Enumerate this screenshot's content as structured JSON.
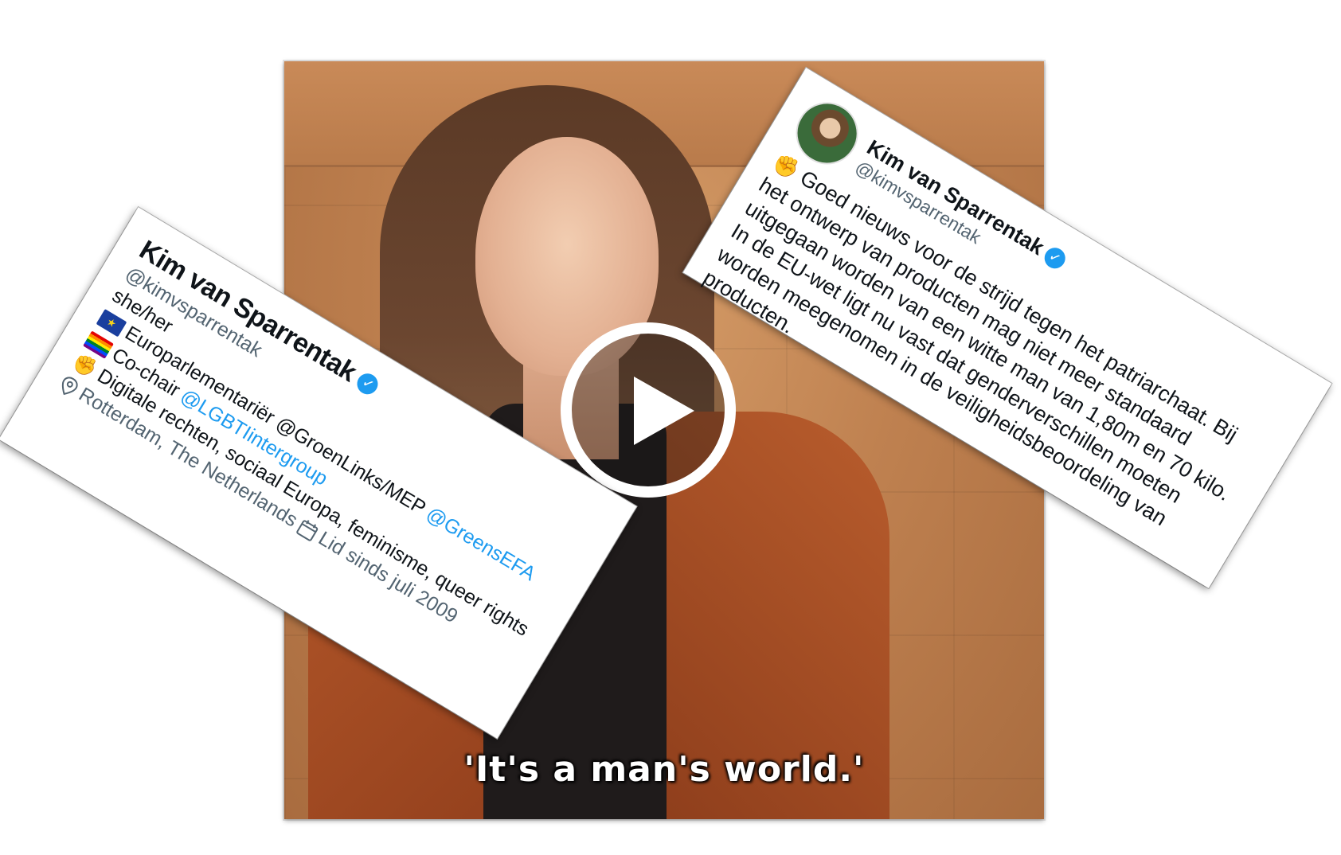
{
  "video": {
    "subtitle": "'It's a man's world.'"
  },
  "profile": {
    "name": "Kim van Sparrentak",
    "handle": "@kimvsparrentak",
    "pronouns": "she/her",
    "bio_line1_prefix": "Europarlementariër @GroenLinks/MEP",
    "bio_line1_link": "@GreensEFA",
    "bio_line2_prefix": "Co-chair",
    "bio_line2_link": "@LGBTIintergroup",
    "bio_line3": "Digitale rechten, sociaal Europa, feminisme, queer rights",
    "location": "Rotterdam, The Netherlands",
    "joined": "Lid sinds juli 2009",
    "icons": [
      "eu-flag-icon",
      "rainbow-flag-icon",
      "raised-fist-icon",
      "location-pin-icon",
      "calendar-icon",
      "verified-badge-icon"
    ]
  },
  "tweet": {
    "name": "Kim van Sparrentak",
    "handle": "@kimvsparrentak",
    "text": "Goed nieuws voor de strijd tegen het patriarchaat. Bij het ontwerp van producten mag niet meer standaard uitgegaan worden van een witte man van 1,80m en 70 kilo. In de EU-wet ligt nu vast dat genderverschillen moeten worden meegenomen in de veiligheidsbeoordeling van producten."
  },
  "colors": {
    "link": "#1d9bf0",
    "muted": "#536471",
    "verified": "#1d9bf0"
  }
}
